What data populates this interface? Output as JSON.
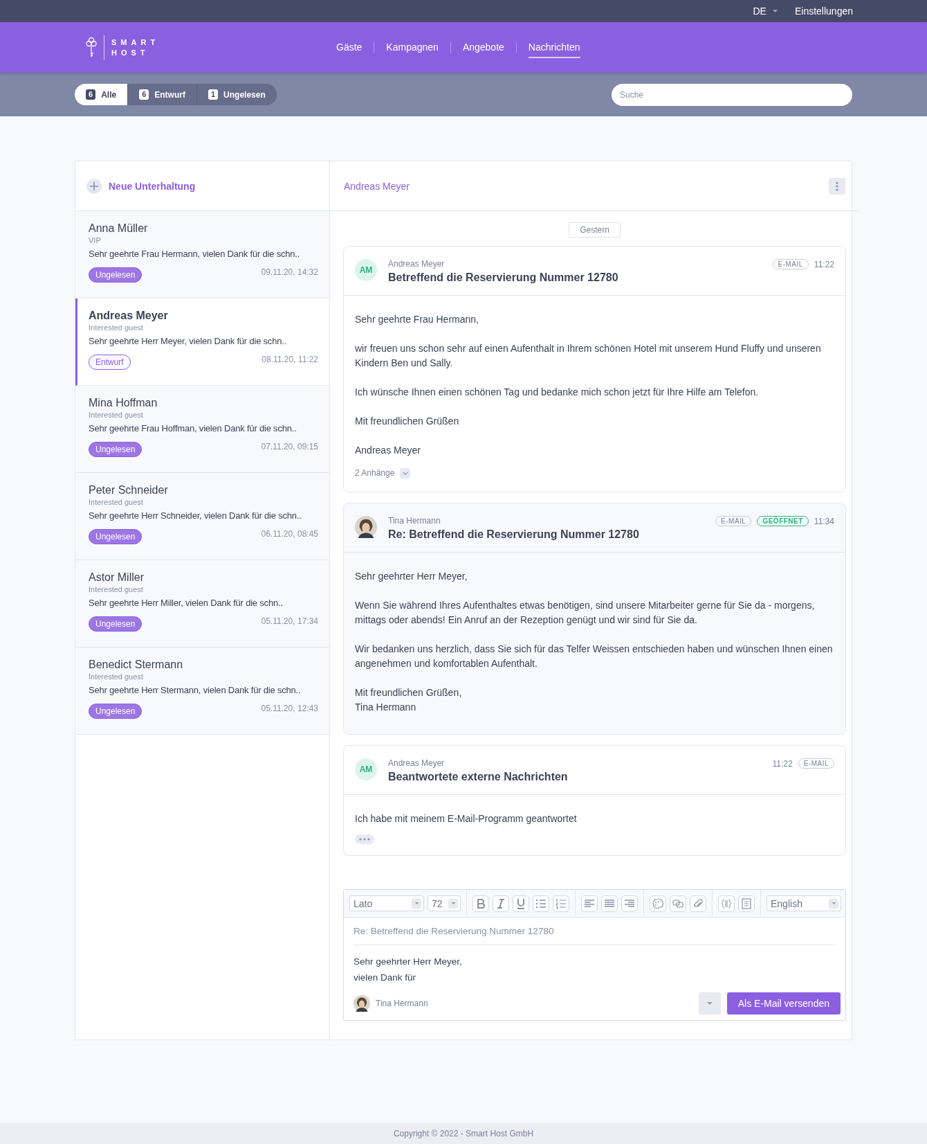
{
  "topbar": {
    "language": "DE",
    "settings": "Einstellungen"
  },
  "logo": {
    "line1": "SMART",
    "line2": "HOST"
  },
  "nav": [
    {
      "label": "Gäste",
      "selected": false
    },
    {
      "label": "Kampagnen",
      "selected": false
    },
    {
      "label": "Angebote",
      "selected": false
    },
    {
      "label": "Nachrichten",
      "selected": true
    }
  ],
  "filters": [
    {
      "count": "6",
      "label": "Alle",
      "selected": true
    },
    {
      "count": "6",
      "label": "Entwurf",
      "selected": false
    },
    {
      "count": "1",
      "label": "Ungelesen",
      "selected": false
    }
  ],
  "search": {
    "placeholder": "Suche"
  },
  "new_conversation": "Neue Unterhaltung",
  "conversations": [
    {
      "name": "Anna Müller",
      "role": "VIP",
      "preview": "Sehr geehrte Frau Hermann, vielen Dank für die schn..",
      "status": {
        "kind": "unread",
        "label": "Ungelesen"
      },
      "time": "09.11.20, 14:32",
      "selected": false
    },
    {
      "name": "Andreas Meyer",
      "role": "Interested guest",
      "preview": "Sehr geehrte Herr Meyer, vielen Dank für die schn..",
      "status": {
        "kind": "draft",
        "label": "Entwurf"
      },
      "time": "08.11.20, 11:22",
      "selected": true
    },
    {
      "name": "Mina Hoffman",
      "role": "Interested guest",
      "preview": "Sehr geehrte Frau Hoffman, vielen Dank für die schn..",
      "status": {
        "kind": "unread",
        "label": "Ungelesen"
      },
      "time": "07.11.20, 09:15",
      "selected": false
    },
    {
      "name": "Peter Schneider",
      "role": "Interested guest",
      "preview": "Sehr geehrte Herr Schneider, vielen Dank für die schn..",
      "status": {
        "kind": "unread",
        "label": "Ungelesen"
      },
      "time": "06.11.20, 08:45",
      "selected": false
    },
    {
      "name": "Astor Miller",
      "role": "Interested guest",
      "preview": "Sehr geehrte Herr Miller, vielen Dank für die schn..",
      "status": {
        "kind": "unread",
        "label": "Ungelesen"
      },
      "time": "05.11.20, 17:34",
      "selected": false
    },
    {
      "name": "Benedict Stermann",
      "role": "Interested guest",
      "preview": "Sehr geehrte Herr Stermann, vielen Dank für die schn..",
      "status": {
        "kind": "unread",
        "label": "Ungelesen"
      },
      "time": "05.11.20, 12:43",
      "selected": false
    }
  ],
  "thread": {
    "title": "Andreas Meyer",
    "date_divider": "Gestern",
    "messages": [
      {
        "avatar": {
          "kind": "initials",
          "text": "AM"
        },
        "sender": "Andreas Meyer",
        "subject": "Betreffend die Reservierung Nummer 12780",
        "meta": [
          {
            "kind": "tag",
            "text": "E-MAIL"
          },
          {
            "kind": "time",
            "text": "11:22"
          }
        ],
        "paragraphs": [
          "Sehr geehrte Frau Hermann,",
          "wir freuen uns schon sehr auf einen Aufenthalt in Ihrem schönen Hotel mit unserem Hund Fluffy und unseren Kindern Ben und Sally.",
          "Ich wünsche Ihnen einen schönen Tag und bedanke mich schon jetzt für Ihre Hilfe am Telefon.",
          "Mit freundlichen Grüßen",
          "Andreas Meyer"
        ],
        "attachments": "2 Anhänge",
        "tinted": false,
        "more": false
      },
      {
        "avatar": {
          "kind": "photo"
        },
        "sender": "Tina Hermann",
        "subject": "Re: Betreffend die Reservierung Nummer 12780",
        "meta": [
          {
            "kind": "tag",
            "text": "E-MAIL"
          },
          {
            "kind": "status",
            "text": "GEÖFFNET"
          },
          {
            "kind": "time",
            "text": "11:34"
          }
        ],
        "paragraphs": [
          "Sehr geehrter Herr Meyer,",
          "Wenn Sie während Ihres Aufenthaltes etwas benötigen, sind unsere Mitarbeiter gerne für Sie da - morgens, mittags oder abends! Ein Anruf an der Rezeption genügt und wir sind für Sie da.",
          "Wir bedanken uns herzlich, dass Sie sich für das Telfer Weissen entschieden haben und wünschen Ihnen einen angenehmen und komfortablen Aufenthalt.",
          "Mit freundlichen Grüßen,\nTina Hermann"
        ],
        "tinted": true,
        "more": false
      },
      {
        "avatar": {
          "kind": "initials",
          "text": "AM"
        },
        "sender": "Andreas Meyer",
        "subject": "Beantwortete externe Nachrichten",
        "meta": [
          {
            "kind": "time",
            "text": "11:22"
          },
          {
            "kind": "tag",
            "text": "E-MAIL"
          }
        ],
        "paragraphs": [
          "Ich habe mit meinem E-Mail-Programm geantwortet"
        ],
        "tinted": false,
        "more": true
      }
    ]
  },
  "composer": {
    "font": "Lato",
    "size": "72",
    "language": "English",
    "subject": "Re: Betreffend die Reservierung Nummer 12780",
    "body": [
      "Sehr geehrter Herr Meyer,",
      "vielen Dank für"
    ],
    "author": "Tina Hermann",
    "send": "Als E-Mail versenden"
  },
  "footer": "Copyright © 2022 - Smart Host GmbH"
}
